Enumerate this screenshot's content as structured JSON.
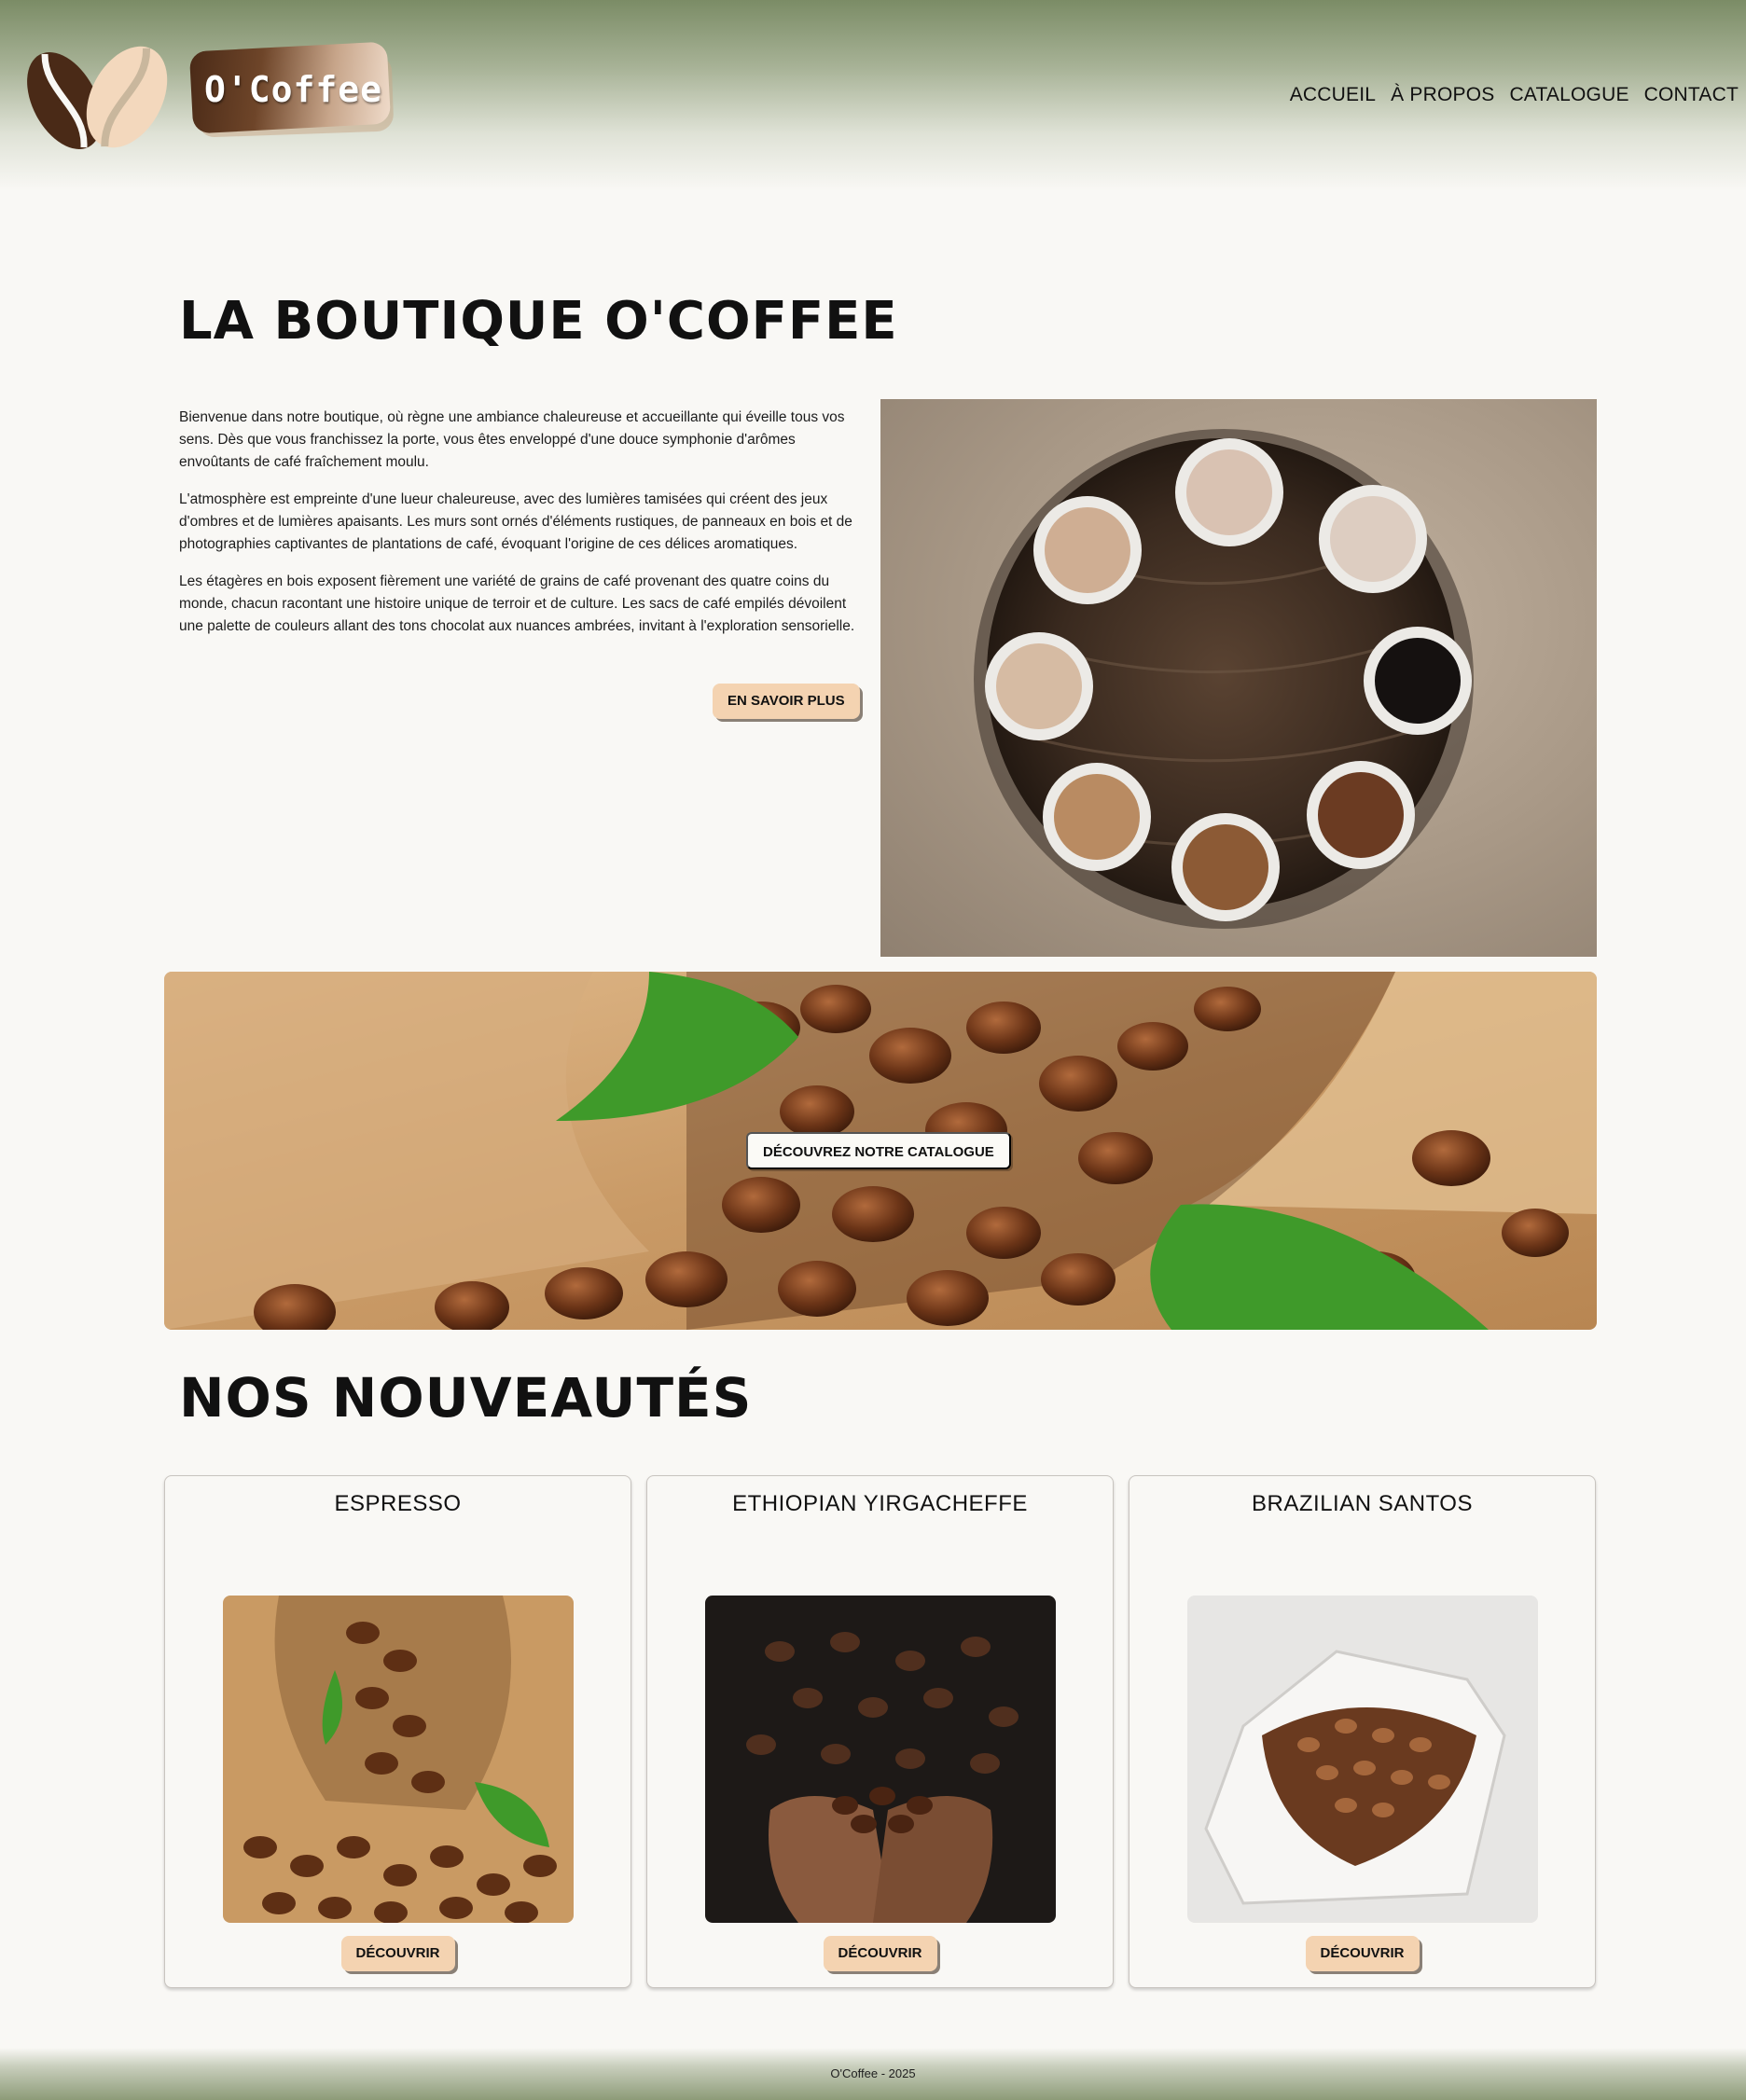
{
  "header": {
    "brand": "O'Coffee",
    "nav": [
      {
        "label": "ACCUEIL"
      },
      {
        "label": "À PROPOS"
      },
      {
        "label": "CATALOGUE"
      },
      {
        "label": "CONTACT"
      }
    ]
  },
  "intro": {
    "title": "LA BOUTIQUE O'COFFEE",
    "paragraphs": [
      "Bienvenue dans notre boutique, où règne une ambiance chaleureuse et accueillante qui éveille tous vos sens. Dès que vous franchissez la porte, vous êtes enveloppé d'une douce symphonie d'arômes envoûtants de café fraîchement moulu.",
      "L'atmosphère est empreinte d'une lueur chaleureuse, avec des lumières tamisées qui créent des jeux d'ombres et de lumières apaisants. Les murs sont ornés d'éléments rustiques, de panneaux en bois et de photographies captivantes de plantations de café, évoquant l'origine de ces délices aromatiques.",
      "Les étagères en bois exposent fièrement une variété de grains de café provenant des quatre coins du monde, chacun racontant une histoire unique de terroir et de culture. Les sacs de café empilés dévoilent une palette de couleurs allant des tons chocolat aux nuances ambrées, invitant à l'exploration sensorielle."
    ],
    "button": "EN SAVOIR PLUS"
  },
  "banner": {
    "button": "DÉCOUVREZ NOTRE CATALOGUE"
  },
  "products": {
    "title": "NOS NOUVEAUTÉS",
    "items": [
      {
        "name": "ESPRESSO",
        "button": "DÉCOUVRIR"
      },
      {
        "name": "ETHIOPIAN YIRGACHEFFE",
        "button": "DÉCOUVRIR"
      },
      {
        "name": "BRAZILIAN SANTOS",
        "button": "DÉCOUVRIR"
      }
    ]
  },
  "footer": {
    "text": "O'Coffee - 2025"
  },
  "colors": {
    "header_green": "#7b8c66",
    "button_peach": "#f4d3b1",
    "logo_brown": "#4a2a17",
    "logo_cream": "#f3d8bd",
    "background": "#f9f8f5"
  },
  "icons": [
    "coffee-beans-logo-icon"
  ]
}
